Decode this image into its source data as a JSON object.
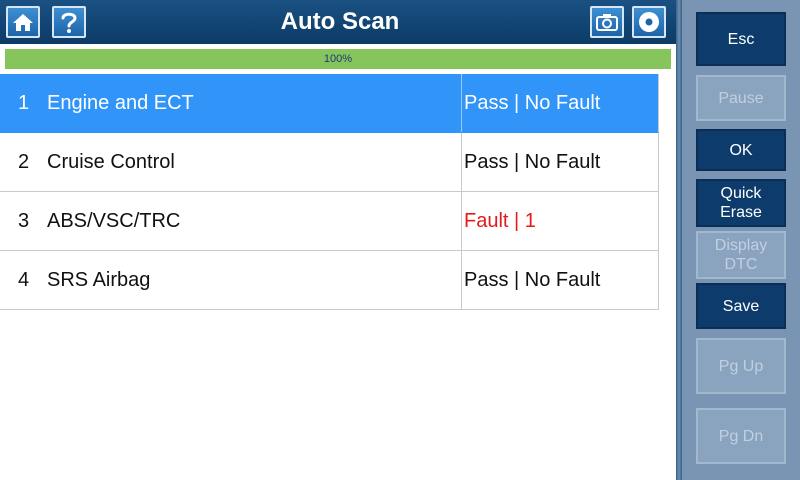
{
  "header": {
    "title": "Auto Scan",
    "home_icon": "home-icon",
    "help_icon": "help-icon",
    "camera_icon": "camera-icon",
    "disc_icon": "disc-icon"
  },
  "progress": {
    "value": 1.0,
    "label": "100%"
  },
  "results": [
    {
      "num": "1",
      "name": "Engine and ECT",
      "status": "Pass | No Fault",
      "fault": false,
      "selected": true
    },
    {
      "num": "2",
      "name": "Cruise Control",
      "status": "Pass | No Fault",
      "fault": false,
      "selected": false
    },
    {
      "num": "3",
      "name": "ABS/VSC/TRC",
      "status": "Fault | 1",
      "fault": true,
      "selected": false
    },
    {
      "num": "4",
      "name": "SRS Airbag",
      "status": "Pass | No Fault",
      "fault": false,
      "selected": false
    }
  ],
  "side_buttons": [
    {
      "key": "esc",
      "label": "Esc",
      "enabled": true
    },
    {
      "key": "pause",
      "label": "Pause",
      "enabled": false
    },
    {
      "key": "ok",
      "label": "OK",
      "enabled": true
    },
    {
      "key": "quick_erase",
      "label": "Quick\nErase",
      "enabled": true
    },
    {
      "key": "display_dtc",
      "label": "Display\nDTC",
      "enabled": false
    },
    {
      "key": "save",
      "label": "Save",
      "enabled": true
    },
    {
      "key": "pg_up",
      "label": "Pg Up",
      "enabled": false
    },
    {
      "key": "pg_dn",
      "label": "Pg Dn",
      "enabled": false
    }
  ],
  "colors": {
    "title_bar": "#0f4272",
    "selected_row": "#3194f8",
    "fault_text": "#e31b1b",
    "progress_fill": "#86c45c",
    "panel": "#7a95b3",
    "button_active": "#0d3c6c"
  }
}
